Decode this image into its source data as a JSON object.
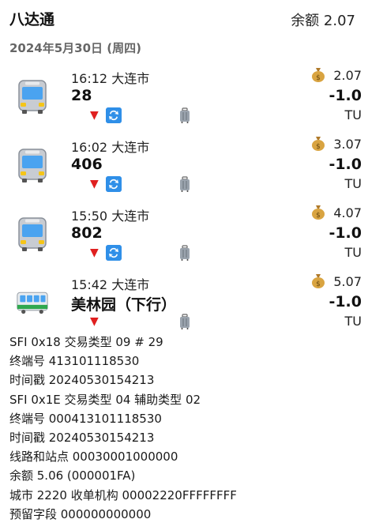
{
  "header": {
    "title": "八达通",
    "balance": "余额 2.07"
  },
  "date_heading": "2024年5月30日 (周四)",
  "icons": {
    "bus": "bus-icon",
    "tram": "tram-icon",
    "money": "money-bag-icon",
    "transfer": "transfer-icon",
    "arrow": "down-triangle-icon",
    "luggage": "luggage-icon"
  },
  "transactions": [
    {
      "time": "16:12  大连市",
      "route": "28",
      "balance_after": "2.07",
      "amount": "-1.0",
      "unit": "TU",
      "vehicle": "bus",
      "transfer": true
    },
    {
      "time": "16:02  大连市",
      "route": "406",
      "balance_after": "3.07",
      "amount": "-1.0",
      "unit": "TU",
      "vehicle": "bus",
      "transfer": true
    },
    {
      "time": "15:50  大连市",
      "route": "802",
      "balance_after": "4.07",
      "amount": "-1.0",
      "unit": "TU",
      "vehicle": "bus",
      "transfer": true
    },
    {
      "time": "15:42  大连市",
      "route": "美林园（下行）",
      "balance_after": "5.07",
      "amount": "-1.0",
      "unit": "TU",
      "vehicle": "tram",
      "transfer": false
    }
  ],
  "raw_lines": [
    "SFI 0x18  交易类型 09  # 29",
    "终端号 413101118530",
    "时间戳 20240530154213",
    "SFI 0x1E  交易类型 04  辅助类型 02",
    "终端号 000413101118530",
    "时间戳 20240530154213",
    "线路和站点 00030001000000",
    "余额 5.06 (000001FA)",
    "城市 2220  收单机构 00002220FFFFFFFF",
    "预留字段 000000000000"
  ]
}
